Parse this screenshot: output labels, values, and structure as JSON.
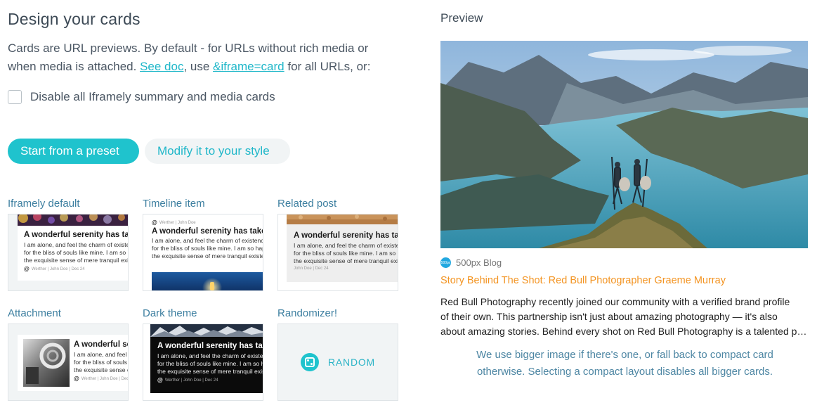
{
  "left": {
    "title": "Design your cards",
    "intro_line1": "Cards are URL previews. By default - for URLs without rich media or",
    "intro_line2_pre": "when media is attached. ",
    "see_doc_link": "See doc",
    "intro_mid": ", use ",
    "iframe_link": "&iframe=card",
    "intro_end": " for all URLs, or:",
    "disable_label": "Disable all Iframely summary and media cards",
    "disable_checked": false,
    "btn_preset": "Start from a preset",
    "btn_modify": "Modify it to your style",
    "presets": [
      {
        "label": "Iframely default"
      },
      {
        "label": "Timeline item"
      },
      {
        "label": "Related post"
      },
      {
        "label": "Attachment"
      },
      {
        "label": "Dark theme"
      },
      {
        "label": "Randomizer!"
      }
    ],
    "card_sample": {
      "title": "A wonderful serenity has taken possession",
      "line1": "I am alone, and feel the charm of existence in this spot",
      "line2": "for the bliss of souls like mine. I am so happy, my friend",
      "line3": "the exquisite sense of mere tranquil existence, that I neglect",
      "meta_author": "Werther",
      "meta_byline": "John Doe",
      "meta_date": "Dec 24",
      "at_sign": "@"
    },
    "random_label": "RANDOM"
  },
  "right": {
    "preview_title": "Preview",
    "provider_name": "500px Blog",
    "provider_icon_text": "500px",
    "story_title": "Story Behind The Shot: Red Bull Photographer Graeme Murray",
    "desc_line1": "Red Bull Photography recently joined our community with a verified brand profile",
    "desc_line2": "of their own. This partnership isn't just about amazing photography — it's also",
    "desc_line3": "about amazing stories. Behind every shot on Red Bull Photography is a talented photographer.",
    "note_line1": "We use bigger image if there's one, or fall back to compact card",
    "note_line2": "otherwise. Selecting a compact layout disables all bigger cards."
  },
  "colors": {
    "accent": "#1fc3cd",
    "link": "#1fb7c9",
    "story_orange": "#f39422",
    "label_blue": "#3d7fa0"
  }
}
